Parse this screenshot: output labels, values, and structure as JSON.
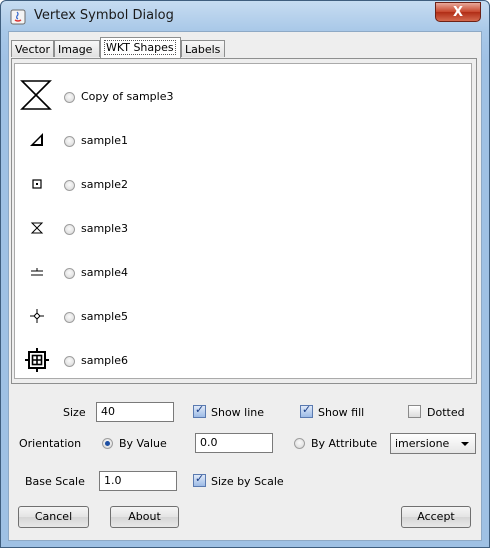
{
  "window": {
    "title": "Vertex Symbol Dialog",
    "close_label": "X"
  },
  "tabs": [
    {
      "label": "Vector"
    },
    {
      "label": "Image"
    },
    {
      "label": "WKT Shapes",
      "active": true
    },
    {
      "label": "Labels"
    }
  ],
  "shapes": [
    {
      "label": "Copy of sample3",
      "icon": "hourglass-large-icon",
      "selected": false
    },
    {
      "label": "sample1",
      "icon": "filled-triangle-icon",
      "selected": false
    },
    {
      "label": "sample2",
      "icon": "square-dot-icon",
      "selected": false
    },
    {
      "label": "sample3",
      "icon": "hourglass-icon",
      "selected": false
    },
    {
      "label": "sample4",
      "icon": "double-line-icon",
      "selected": false
    },
    {
      "label": "sample5",
      "icon": "star-cross-icon",
      "selected": false
    },
    {
      "label": "sample6",
      "icon": "target-square-icon",
      "selected": false
    }
  ],
  "controls": {
    "size_label": "Size",
    "size_value": "40",
    "show_line_label": "Show line",
    "show_line_checked": true,
    "show_fill_label": "Show fill",
    "show_fill_checked": true,
    "dotted_label": "Dotted",
    "dotted_checked": false,
    "orientation_label": "Orientation",
    "by_value_label": "By Value",
    "by_value_selected": true,
    "orientation_value": "0.0",
    "by_attribute_label": "By Attribute",
    "by_attribute_selected": false,
    "attribute_selected": "imersione",
    "base_scale_label": "Base Scale",
    "base_scale_value": "1.0",
    "size_by_scale_label": "Size by Scale",
    "size_by_scale_checked": true
  },
  "buttons": {
    "cancel": "Cancel",
    "about": "About",
    "accept": "Accept"
  }
}
